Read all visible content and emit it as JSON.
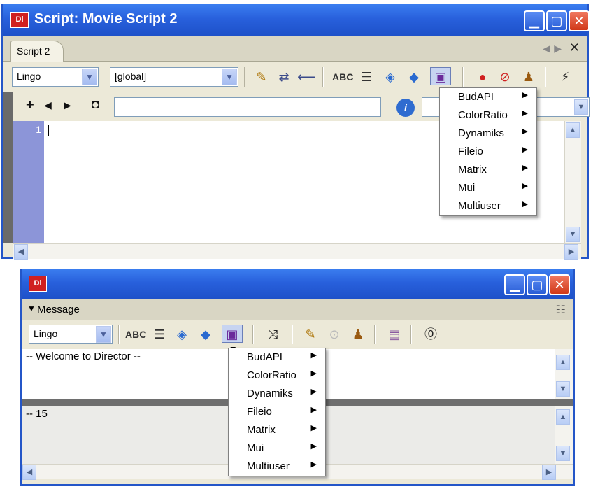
{
  "top_window": {
    "title": "Script: Movie Script 2",
    "app_icon": "Di",
    "tab_label": "Script 2",
    "tab_nav_left": "◀",
    "tab_nav_right": "▶",
    "tab_close": "✕",
    "toolbar": {
      "language": "Lingo",
      "scope": "[global]"
    },
    "line_number": "1",
    "icons": [
      "comment-icon",
      "wrap-icon",
      "unwrap-icon",
      "spelling-icon",
      "autoformat-icon",
      "lingo-categorized-icon",
      "lingo-alpha-icon",
      "xtra-scripting-icon",
      "breakpoint-icon",
      "ignore-breakpoints-icon",
      "watch-icon",
      "recompile-icon"
    ]
  },
  "bottom_window": {
    "app_icon": "Di",
    "header_label": "Message",
    "toolbar": {
      "language": "Lingo"
    },
    "input_text": "-- Welcome to Director --",
    "output_text": "-- 15"
  },
  "xtras_menu": {
    "items": [
      {
        "label": "BudAPI"
      },
      {
        "label": "ColorRatio"
      },
      {
        "label": "Dynamiks"
      },
      {
        "label": "Fileio"
      },
      {
        "label": "Matrix"
      },
      {
        "label": "Mui"
      },
      {
        "label": "Multiuser"
      }
    ]
  },
  "colors": {
    "title_bar": "#2860dc",
    "gutter": "#8c95d8",
    "window_face": "#ece9d8",
    "close_button": "#d03818"
  }
}
